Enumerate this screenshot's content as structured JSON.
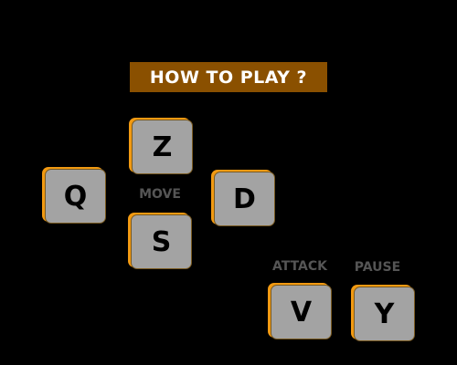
{
  "title": "HOW TO PLAY ?",
  "keys": {
    "up": "Z",
    "left": "Q",
    "right": "D",
    "down": "S",
    "attack": "V",
    "pause": "Y"
  },
  "labels": {
    "move": "MOVE",
    "attack": "ATTACK",
    "pause": "PAUSE"
  },
  "colors": {
    "title_bg": "#8a5000",
    "key_fill": "#a3a3a3",
    "key_accent": "#f29a12",
    "label": "#555555"
  }
}
